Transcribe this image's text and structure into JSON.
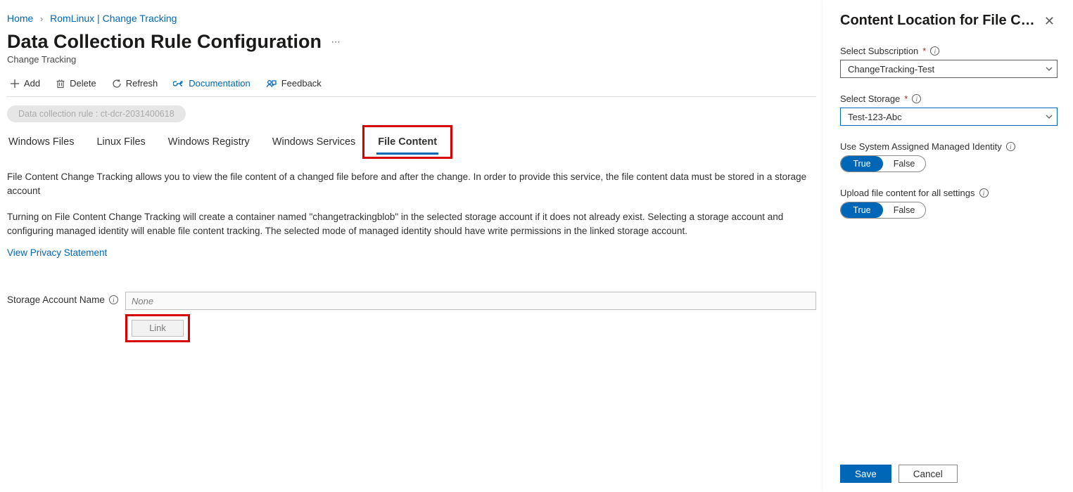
{
  "breadcrumb": {
    "home": "Home",
    "path": "RomLinux | Change Tracking"
  },
  "header": {
    "title": "Data Collection Rule Configuration",
    "subtitle": "Change Tracking"
  },
  "toolbar": {
    "add": "Add",
    "delete": "Delete",
    "refresh": "Refresh",
    "documentation": "Documentation",
    "feedback": "Feedback"
  },
  "dcr_pill": "Data collection rule : ct-dcr-2031400618",
  "tabs": {
    "windows_files": "Windows Files",
    "linux_files": "Linux Files",
    "windows_registry": "Windows Registry",
    "windows_services": "Windows Services",
    "file_content": "File Content"
  },
  "body": {
    "p1": "File Content Change Tracking allows you to view the file content of a changed file before and after the change. In order to provide this service, the file content data must be stored in a storage account",
    "p2": "Turning on File Content Change Tracking will create a container named \"changetrackingblob\" in the selected storage account if it does not already exist. Selecting a storage account and configuring managed identity will enable file content tracking. The selected mode of managed identity should have write permissions in the linked storage account.",
    "privacy": "View Privacy Statement"
  },
  "storage": {
    "label": "Storage Account Name",
    "value": "None",
    "link_button": "Link"
  },
  "panel": {
    "title": "Content Location for File Content Change Tracking",
    "subscription_label": "Select Subscription",
    "subscription_value": "ChangeTracking-Test",
    "storage_label": "Select Storage",
    "storage_value": "Test-123-Abc",
    "identity_label": "Use System Assigned Managed Identity",
    "upload_label": "Upload file content for all settings",
    "toggle_true": "True",
    "toggle_false": "False",
    "save": "Save",
    "cancel": "Cancel"
  }
}
